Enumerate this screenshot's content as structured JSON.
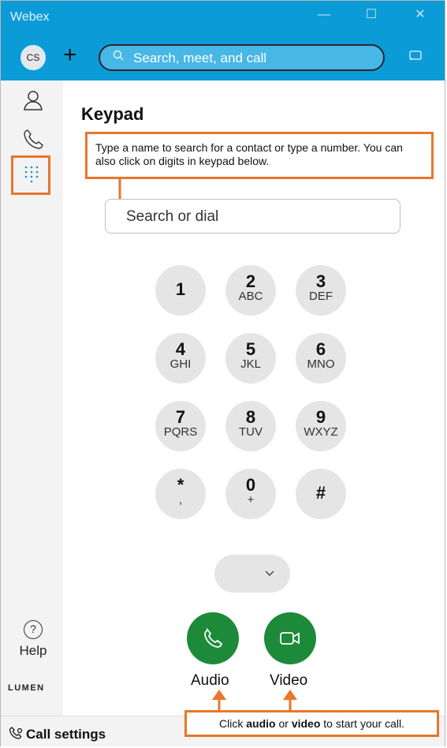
{
  "window": {
    "app_title": "Webex",
    "minimize": "—",
    "maximize": "☐",
    "close": "✕"
  },
  "header": {
    "avatar_initials": "CS",
    "new_label": "+",
    "search_placeholder": "Search, meet, and call"
  },
  "sidebar": {
    "help_label": "Help",
    "brand": "LUMEN"
  },
  "main": {
    "title": "Keypad",
    "tip_search": "Type a name to search for a contact or type a number. You can also click on digits in keypad below.",
    "dial_placeholder": "Search or dial",
    "keys": [
      {
        "digit": "1",
        "letters": ""
      },
      {
        "digit": "2",
        "letters": "ABC"
      },
      {
        "digit": "3",
        "letters": "DEF"
      },
      {
        "digit": "4",
        "letters": "GHI"
      },
      {
        "digit": "5",
        "letters": "JKL"
      },
      {
        "digit": "6",
        "letters": "MNO"
      },
      {
        "digit": "7",
        "letters": "PQRS"
      },
      {
        "digit": "8",
        "letters": "TUV"
      },
      {
        "digit": "9",
        "letters": "WXYZ"
      },
      {
        "digit": "*",
        "letters": ","
      },
      {
        "digit": "0",
        "letters": "+"
      },
      {
        "digit": "#",
        "letters": ""
      }
    ],
    "audio_label": "Audio",
    "video_label": "Video",
    "tip_call_pre": "Click ",
    "tip_call_audio": "audio",
    "tip_call_mid": " or ",
    "tip_call_video": "video",
    "tip_call_post": " to start your call."
  },
  "footer": {
    "call_settings": "Call settings"
  },
  "colors": {
    "titlebar": "#0b9bd6",
    "accent_orange": "#e8762c",
    "call_green": "#1d8a3a"
  }
}
